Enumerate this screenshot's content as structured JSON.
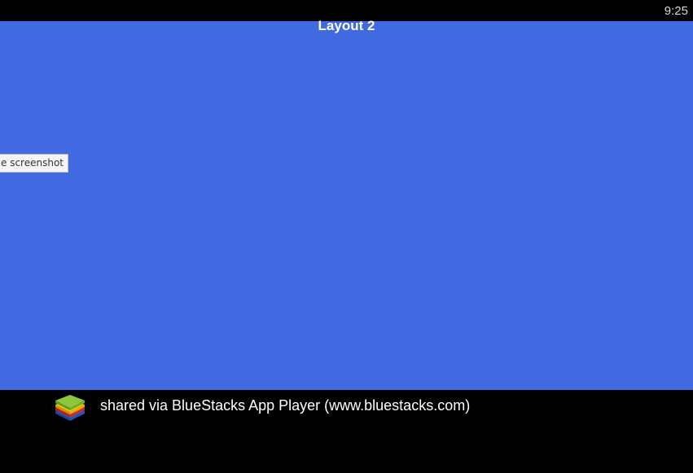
{
  "status_bar": {
    "time": "9:25"
  },
  "app_screen": {
    "title": "Layout 2",
    "background_color": "#4169e1",
    "tooltip": "e screenshot"
  },
  "footer": {
    "logo_icon": "bluestacks-logo-icon",
    "text": "shared via BlueStacks App Player (www.bluestacks.com)"
  }
}
